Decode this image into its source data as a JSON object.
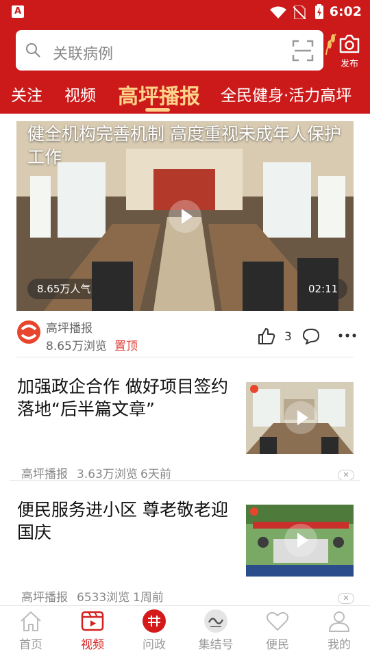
{
  "status": {
    "time": "6:02",
    "app_badge": "A"
  },
  "search": {
    "placeholder": "关联病例",
    "publish_label": "发布"
  },
  "tabs": [
    {
      "label": "关注",
      "active": false
    },
    {
      "label": "视频",
      "active": false
    },
    {
      "label": "高坪播报",
      "active": true
    },
    {
      "label": "全民健身·活力高坪",
      "active": false
    }
  ],
  "featured": {
    "title": "健全机构完善机制 高度重视未成年人保护工作",
    "popularity": "8.65万人气",
    "duration": "02:11",
    "source": "高坪播报",
    "views": "8.65万浏览",
    "pinned": "置顶",
    "likes": "3"
  },
  "items": [
    {
      "title": "加强政企合作 做好项目签约落地“后半篇文章”",
      "source": "高坪播报",
      "views": "3.63万浏览",
      "time": "6天前"
    },
    {
      "title": "便民服务进小区 尊老敬老迎国庆",
      "source": "高坪播报",
      "views": "6533浏览",
      "time": "1周前"
    }
  ],
  "nav": [
    {
      "label": "首页",
      "active": false
    },
    {
      "label": "视频",
      "active": true
    },
    {
      "label": "问政",
      "active": false
    },
    {
      "label": "集结号",
      "active": false
    },
    {
      "label": "便民",
      "active": false
    },
    {
      "label": "我的",
      "active": false
    }
  ],
  "colors": {
    "brand": "#cc1a1a",
    "active_tab": "#ffd28a",
    "pinned": "#e0423a"
  }
}
